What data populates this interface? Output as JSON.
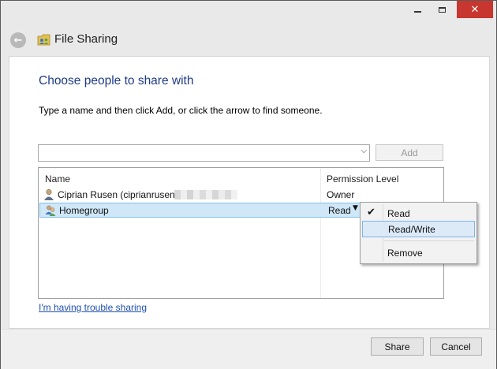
{
  "window": {
    "title": "File Sharing",
    "controls": {
      "minimize": "minimize",
      "maximize": "maximize",
      "close": "✕"
    },
    "back_glyph": "←",
    "close_color": "#c7372f"
  },
  "main": {
    "heading": "Choose people to share with",
    "instruction": "Type a name and then click Add, or click the arrow to find someone.",
    "name_input": {
      "value": "",
      "placeholder": ""
    },
    "add_label": "Add",
    "trouble_link": "I'm having trouble sharing"
  },
  "grid": {
    "columns": [
      "Name",
      "Permission Level"
    ],
    "rows": [
      {
        "name": "Ciprian Rusen (ciprianrusen",
        "permission": "Owner",
        "icon": "user-icon"
      },
      {
        "name": "Homegroup",
        "permission": "Read",
        "icon": "homegroup-icon",
        "selected": true
      }
    ]
  },
  "permission_menu": {
    "items": [
      {
        "label": "Read",
        "checked": true
      },
      {
        "label": "Read/Write",
        "highlighted": true
      },
      {
        "label": "Remove"
      }
    ],
    "check_glyph": "✔"
  },
  "footer": {
    "share_label": "Share",
    "cancel_label": "Cancel"
  },
  "colors": {
    "heading": "#1e3a87",
    "link": "#1f4fb0",
    "selection": "#cfe7f7",
    "menu_highlight": "#dceaf8"
  }
}
